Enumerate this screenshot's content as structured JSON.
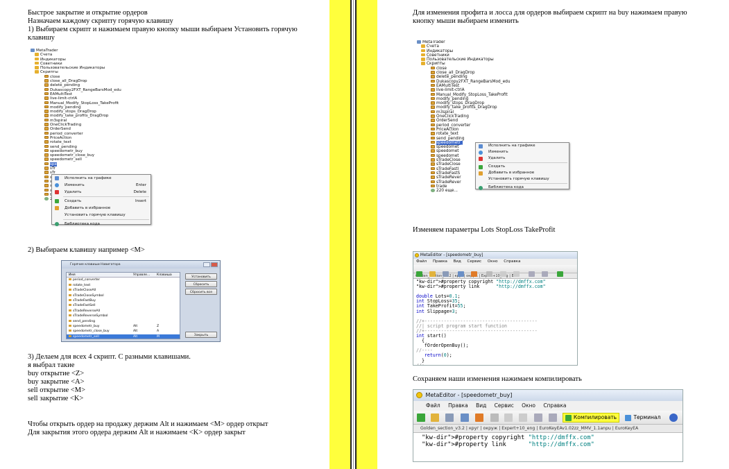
{
  "left": {
    "heading": "Быстрое закрытие и открытие ордеров",
    "intro": "Назначаем каждому скрипту горячую клавишу",
    "step1_line1": "1) Выбираем скрипт и нажимаем правую кнопку мыши выбираем Установить горячую",
    "step1_line2": "клавишу",
    "step2": "2) Выбираем клавишу например <M>",
    "step3": "3) Делаем для всех 4 скрипт. С разными клавишами.",
    "chosen_intro": "я выбрал такие",
    "keys": [
      "buy открытие <Z>",
      "buy закрытие <A>",
      "sell открытие <M>",
      "sell закрытие <K>"
    ],
    "outro_line1": "Чтобы открыть ордер на продажу держим Alt и нажимаем <M> ордер открыт",
    "outro_line2": "Для закрытия этого ордера держим  Alt и нажимаем <K> ордер закрыт"
  },
  "right": {
    "para1_line1": "Для изменения профита и лосса для ордеров выбираем скрипт на buy нажимаем правую",
    "para1_line2": "кнопку мыши выбираем   изменить",
    "para2": "Изменяем параметры Lots StopLoss TakeProfit",
    "para3": "Сохраняем наши изменения нажимаем компилировать"
  },
  "navigator_left": {
    "root": "MetaTrader",
    "folders": [
      "Счета",
      "Индикаторы",
      "Советники",
      "Пользовательские Индикаторы",
      "Скрипты"
    ],
    "scripts": [
      "close",
      "close_all_DragDrop",
      "delete_pending",
      "Dukascopy2FXT_RangeBarsMod_edu",
      "EAMultiTest",
      "live-limit-ctrlA",
      "Manual_Modify_StopLoss_TakeProfit",
      "modify_pending",
      "modify_stops_DragDrop",
      "modify_take_profits_DragDrop",
      "m3spiral",
      "OneClickTrading",
      "OrderSend",
      "period_converter",
      "PriceAction",
      "rotate_text",
      "send_pending",
      "speedometr_buy",
      "speedometr_close_buy",
      "speedometr_sell",
      "spe",
      "sTr",
      "sTr",
      "sTr",
      "sTr",
      "sTr",
      "sTr",
      "tra"
    ],
    "more": "220",
    "menu": [
      {
        "label": "Исполнить на графике",
        "shortcut": ""
      },
      {
        "label": "Изменить",
        "shortcut": "Enter"
      },
      {
        "label": "Удалить",
        "shortcut": "Delete"
      },
      {
        "label": "Создать",
        "shortcut": "Insert"
      },
      {
        "label": "Добавить в избранное",
        "shortcut": ""
      },
      {
        "label": "Установить горячую клавишу",
        "shortcut": ""
      },
      {
        "label": "Библиотека кода",
        "shortcut": ""
      }
    ]
  },
  "hotkeys": {
    "title": "Горячие клавиши Навигатора",
    "col_name": "Имя",
    "col_ctrl": "Управле...",
    "col_key": "Клавиша",
    "rows": [
      {
        "name": "period_converter",
        "ctrl": "",
        "key": ""
      },
      {
        "name": "rotate_text",
        "ctrl": "",
        "key": ""
      },
      {
        "name": "sTradeCloseAll",
        "ctrl": "",
        "key": ""
      },
      {
        "name": "sTradeCloseSymbol",
        "ctrl": "",
        "key": ""
      },
      {
        "name": "sTradeFastBuy",
        "ctrl": "",
        "key": ""
      },
      {
        "name": "sTradeFastSell",
        "ctrl": "",
        "key": ""
      },
      {
        "name": "sTradeReverseAll",
        "ctrl": "",
        "key": ""
      },
      {
        "name": "sTradeReverseSymbol",
        "ctrl": "",
        "key": ""
      },
      {
        "name": "send_pending",
        "ctrl": "",
        "key": ""
      },
      {
        "name": "speedometr_buy",
        "ctrl": "Alt",
        "key": "Z"
      },
      {
        "name": "speedometr_close_buy",
        "ctrl": "Alt",
        "key": "A"
      },
      {
        "name": "speedometr_sell",
        "ctrl": "Alt",
        "key": "M"
      }
    ],
    "btn_set": "Установить",
    "btn_reset": "Сбросить",
    "btn_reset_all": "Сбросить все",
    "btn_close": "Закрыть"
  },
  "navigator_right": {
    "root": "MetaTrader",
    "folders": [
      "Счета",
      "Индикаторы",
      "Советники",
      "Пользовательские Индикаторы",
      "Скрипты"
    ],
    "scripts": [
      "close",
      "close_all_DragDrop",
      "delete_pending",
      "Dukascopy2FXT_RangeBarsMod_edu",
      "EAMultiTest",
      "live-limit-ctrlA",
      "Manual_Modify_StopLoss_TakeProfit",
      "modify_pending",
      "modify_stops_DragDrop",
      "modify_take_profits_DragDrop",
      "m3spiral",
      "OneClickTrading",
      "OrderSend",
      "period_converter",
      "PriceAction",
      "rotate_text",
      "send_pending",
      "speedometr_",
      "speedomet",
      "speedomet",
      "speedomet",
      "sTradeClose",
      "sTradeClose",
      "sTradeFastI",
      "sTradeFastS",
      "sTradeRever",
      "sTradeRever",
      "trade"
    ],
    "more": "220 еще...",
    "menu": [
      {
        "label": "Исполнить на графике"
      },
      {
        "label": "Изменить"
      },
      {
        "label": "Удалить"
      },
      {
        "label": "Создать"
      },
      {
        "label": "Добавить в избранное"
      },
      {
        "label": "Установить горячую клавишу"
      },
      {
        "label": "Библиотека кода"
      }
    ]
  },
  "editor1": {
    "title": "MetaEditor - [speedometr_buy]",
    "menu": [
      "Файл",
      "Правка",
      "Вид",
      "Сервис",
      "Окно",
      "Справка"
    ],
    "tabs": "Golden_section_v3.2  |  круг  |  окруж  |  Expert+10_eng  |  Eur",
    "code": [
      "#property copyright \"http://dmffx.com\"",
      "#property link      \"http://dmffx.com\"",
      "",
      "double Lots=0.1;",
      "int StopLoss=35;",
      "int TakeProfit=55;",
      "int Slippage=3;",
      "",
      "//+-----------------------------------------",
      "//| script program start function",
      "//+-----------------------------------------",
      "int start()",
      "  {",
      "   fOrderOpenBuy();",
      "//----",
      "   return(0);",
      "  }",
      "//+-----------------------------------------"
    ]
  },
  "editor2": {
    "title": "MetaEditor - [speedometr_buy]",
    "menu": [
      "Файл",
      "Правка",
      "Вид",
      "Сервис",
      "Окно",
      "Справка"
    ],
    "compile_label": "Компилировать",
    "terminal_label": "Терминал",
    "tabs": "Golden_section_v3.2  |  круг  |  окруж  |  Expert+10_eng  |  EuroKeyEAv1.02zz_MMV_1.1anpu  |  EuroKeyEA",
    "code": [
      "#property copyright \"http://dmffx.com\"",
      "#property link      \"http://dmffx.com\""
    ]
  }
}
